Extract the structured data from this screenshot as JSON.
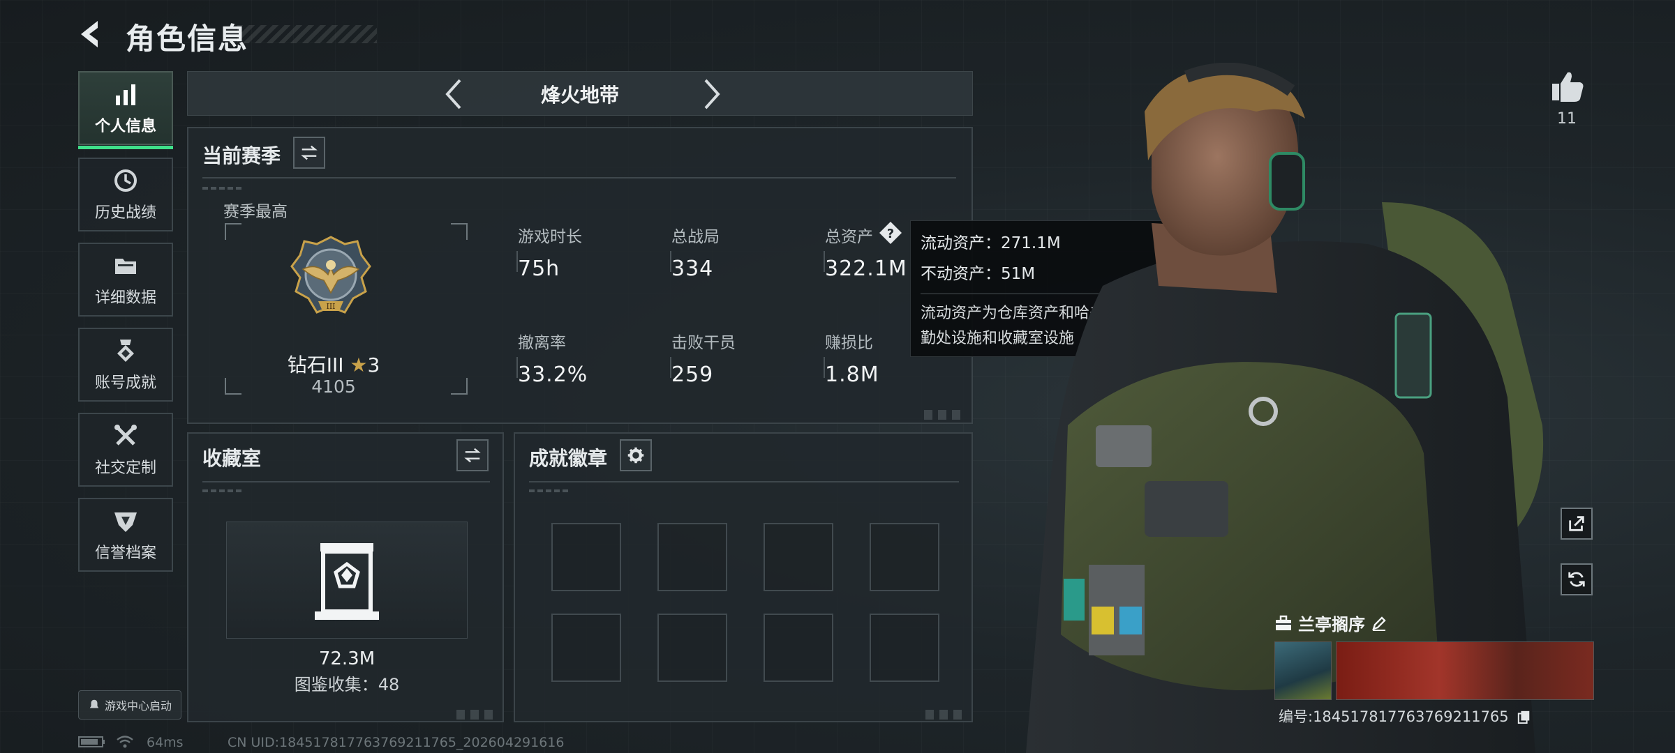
{
  "header": {
    "title": "角色信息"
  },
  "sidebar": {
    "items": [
      {
        "label": "个人信息",
        "icon": "bar-chart-icon"
      },
      {
        "label": "历史战绩",
        "icon": "history-clock-icon"
      },
      {
        "label": "详细数据",
        "icon": "folder-icon"
      },
      {
        "label": "账号成就",
        "icon": "medal-icon"
      },
      {
        "label": "社交定制",
        "icon": "tools-icon"
      },
      {
        "label": "信誉档案",
        "icon": "shield-wing-icon"
      }
    ],
    "launch_label": "游戏中心启动"
  },
  "mode": {
    "name": "烽火地带"
  },
  "season": {
    "title": "当前赛季",
    "best_label": "赛季最高",
    "rank_name": "钻石III",
    "rank_stars": "3",
    "rank_points": "4105",
    "stats": [
      {
        "label": "游戏时长",
        "value": "75h"
      },
      {
        "label": "总战局",
        "value": "334"
      },
      {
        "label": "总资产",
        "value": "322.1M"
      },
      {
        "label": "撤离率",
        "value": "33.2%"
      },
      {
        "label": "击败干员",
        "value": "259"
      },
      {
        "label": "赚损比",
        "value": "1.8M"
      }
    ]
  },
  "tooltip": {
    "liquid": "流动资产：271.1M",
    "fixed": "不动资产：51M",
    "description": "流动资产为仓库资产和哈夫币，不动资产为特勤处设施和收藏室设施"
  },
  "collection": {
    "title": "收藏室",
    "value": "72.3M",
    "count_text": "图鉴收集：48"
  },
  "achievements": {
    "title": "成就徽章"
  },
  "profile": {
    "likes": "11",
    "name": "兰亭搁序",
    "serial": "编号:1845178177637692117​65"
  },
  "status": {
    "ping": "64ms",
    "uid": "CN UID:1845178177637692117​65_202604291616"
  },
  "colors": {
    "accent": "#3fe08a",
    "panel": "#21282c",
    "gold": "#c9a24a"
  }
}
